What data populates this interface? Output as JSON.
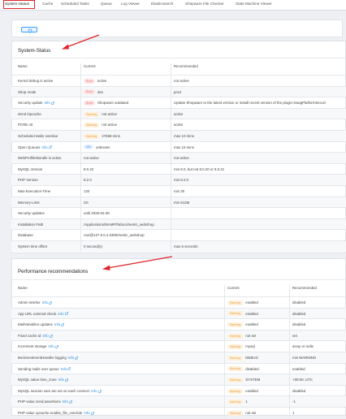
{
  "tabs": [
    "System-Status",
    "Cache",
    "Scheduled Tasks",
    "Queue",
    "Log Viewer",
    "Elasticsearch",
    "Shopware File Checker",
    "State Machine Viewer"
  ],
  "colors": {
    "accent": "#e0242b",
    "link": "#2b8de0",
    "error": "#e26565",
    "warning": "#e7a245",
    "info": "#4a90e2"
  },
  "system": {
    "title": "System-Status",
    "headers": {
      "name": "Name",
      "current": "Current",
      "recommended": "Recommended"
    },
    "rows": [
      {
        "name": "Kernel debug is active",
        "badge": "Error",
        "level": "error",
        "current": "active",
        "recommended": "not active"
      },
      {
        "name": "Shop mode",
        "badge": "Error",
        "level": "error",
        "current": "dev",
        "recommended": "prod"
      },
      {
        "name": "Security update",
        "info": "Info",
        "badge": "Error",
        "level": "error",
        "current": "Shopware outdated",
        "recommended": "Update Shopware to the latest version or install recent version of the plugin SwagPlatformSecuri"
      },
      {
        "name": "Zend Opcache",
        "badge": "Warning",
        "level": "warning",
        "current": "not active",
        "recommended": "active"
      },
      {
        "name": "PCRE-Jit",
        "badge": "Warning",
        "level": "warning",
        "current": "not active",
        "recommended": "active"
      },
      {
        "name": "Scheduled tasks overdue",
        "badge": "Warning",
        "level": "warning",
        "current": "47658 mins",
        "recommended": "max 10 mins"
      },
      {
        "name": "Open Queues",
        "info": "Info",
        "badge": "Info",
        "level": "info",
        "current": "unknown",
        "recommended": "max 15 mins"
      },
      {
        "name": "WebProfilerBundle is active",
        "current": "not active",
        "recommended": "not active"
      },
      {
        "name": "MySQL Version",
        "current": "8.0.42",
        "recommended": "min 8.0, but not 8.0.20 or 8.0.21"
      },
      {
        "name": "PHP Version",
        "current": "8.2.0",
        "recommended": "min 8.2.0"
      },
      {
        "name": "Max-Execution-Time",
        "current": "120",
        "recommended": "min 30"
      },
      {
        "name": "Memory-Limit",
        "current": "2G",
        "recommended": "min 512M"
      },
      {
        "name": "Security updates",
        "current": "until 2026-02-28",
        "recommended": ""
      },
      {
        "name": "Installation Path",
        "current": "/Applications/MAMP/htdocs/metric_webshop",
        "recommended": ""
      },
      {
        "name": "Database",
        "current": "root@127.0.0.1:3306/metric_webshop",
        "recommended": ""
      },
      {
        "name": "System time offset",
        "current": "0 second(s)",
        "recommended": "max 5 seconds"
      }
    ]
  },
  "performance": {
    "title": "Performance recommendations",
    "headers": {
      "name": "Name",
      "current": "Current",
      "recommended": "Recommended"
    },
    "rows": [
      {
        "name": "Admin Worker",
        "info": "Info",
        "badge": "Warning",
        "current": "enabled",
        "recommended": "disabled"
      },
      {
        "name": "App URL external check",
        "info": "Info",
        "badge": "Warning",
        "current": "enabled",
        "recommended": "disabled"
      },
      {
        "name": "MailVariables updates",
        "info": "Info",
        "badge": "Warning",
        "current": "enabled",
        "recommended": "disabled"
      },
      {
        "name": "Fixed cache id",
        "info": "Info",
        "badge": "Warning",
        "current": "not set",
        "recommended": "set"
      },
      {
        "name": "Increment storage",
        "info": "Info",
        "badge": "Warning",
        "current": "mysql",
        "recommended": "array or redis"
      },
      {
        "name": "BusinessEventHandler logging",
        "info": "Info",
        "badge": "Warning",
        "current": "DEBUG",
        "recommended": "min WARNING"
      },
      {
        "name": "Sending mails over queue",
        "info": "Info",
        "badge": "Warning",
        "current": "disabled",
        "recommended": "enabled"
      },
      {
        "name": "MySQL value time_zone",
        "info": "Info",
        "badge": "Warning",
        "current": "SYSTEM",
        "recommended": "+00:00, UTC"
      },
      {
        "name": "MySQL session vars are set on each connect",
        "info": "Info",
        "badge": "Warning",
        "current": "enabled",
        "recommended": "disabled"
      },
      {
        "name": "PHP value zend.assertions",
        "info": "Info",
        "badge": "Warning",
        "current": "1",
        "recommended": "-1"
      },
      {
        "name": "PHP value opcache.enable_file_override",
        "info": "Info",
        "badge": "Warning",
        "current": "not set",
        "recommended": "1"
      }
    ]
  }
}
